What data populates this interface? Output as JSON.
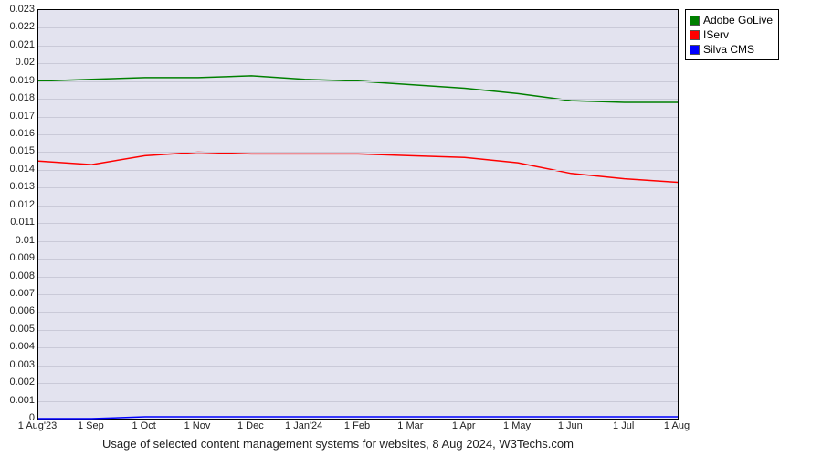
{
  "chart_data": {
    "type": "line",
    "title": "Usage of selected content management systems for websites, 8 Aug 2024, W3Techs.com",
    "xlabel": "",
    "ylabel": "",
    "ylim": [
      0,
      0.023
    ],
    "categories": [
      "1 Aug'23",
      "1 Sep",
      "1 Oct",
      "1 Nov",
      "1 Dec",
      "1 Jan'24",
      "1 Feb",
      "1 Mar",
      "1 Apr",
      "1 May",
      "1 Jun",
      "1 Jul",
      "1 Aug"
    ],
    "series": [
      {
        "name": "Adobe GoLive",
        "color": "#008000",
        "values": [
          0.019,
          0.0191,
          0.0192,
          0.0192,
          0.0193,
          0.0191,
          0.019,
          0.0188,
          0.0186,
          0.0183,
          0.0179,
          0.0178,
          0.0178
        ]
      },
      {
        "name": "IServ",
        "color": "#ff0000",
        "values": [
          0.0145,
          0.0143,
          0.0148,
          0.015,
          0.0149,
          0.0149,
          0.0149,
          0.0148,
          0.0147,
          0.0144,
          0.0138,
          0.0135,
          0.0133
        ]
      },
      {
        "name": "Silva CMS",
        "color": "#0000ff",
        "values": [
          0.0,
          0.0,
          0.0001,
          0.0001,
          0.0001,
          0.0001,
          0.0001,
          0.0001,
          0.0001,
          0.0001,
          0.0001,
          0.0001,
          0.0001
        ]
      }
    ],
    "y_ticks": [
      0,
      0.001,
      0.002,
      0.003,
      0.004,
      0.005,
      0.006,
      0.007,
      0.008,
      0.009,
      0.01,
      0.011,
      0.012,
      0.013,
      0.014,
      0.015,
      0.016,
      0.017,
      0.018,
      0.019,
      0.02,
      0.021,
      0.022,
      0.023
    ]
  }
}
